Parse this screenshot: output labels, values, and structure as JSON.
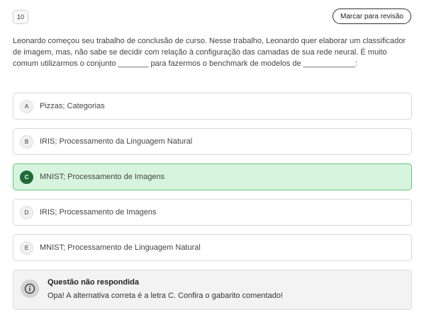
{
  "question_number": "10",
  "review_button_label": "Marcar para revisão",
  "question_text": "Leonardo começou seu trabalho de conclusão de curso. Nesse trabalho, Leonardo quer elaborar um classificador de imagem, mas, não sabe se decidir com relação à configuração das camadas de sua rede neural. É muito comum utilizarmos o conjunto _______ para fazermos o benchmark de modelos de ____________:",
  "options": [
    {
      "letter": "A",
      "text": "Pizzas; Categorias",
      "selected": false
    },
    {
      "letter": "B",
      "text": "IRIS; Processamento da Linguagem Natural",
      "selected": false
    },
    {
      "letter": "C",
      "text": "MNIST; Processamento de Imagens",
      "selected": true
    },
    {
      "letter": "D",
      "text": "IRIS; Processamento de Imagens",
      "selected": false
    },
    {
      "letter": "E",
      "text": "MNIST; Processamento de Linguagem Natural",
      "selected": false
    }
  ],
  "feedback": {
    "title": "Questão não respondida",
    "text": "Opa! A alternativa correta é a letra C. Confira o gabarito comentado!"
  },
  "colors": {
    "selected_bg": "#d7f5de",
    "selected_border": "#5cc47a",
    "selected_letter_bg": "#1f6b35"
  },
  "icons": {
    "feedback_icon": "info-icon"
  }
}
